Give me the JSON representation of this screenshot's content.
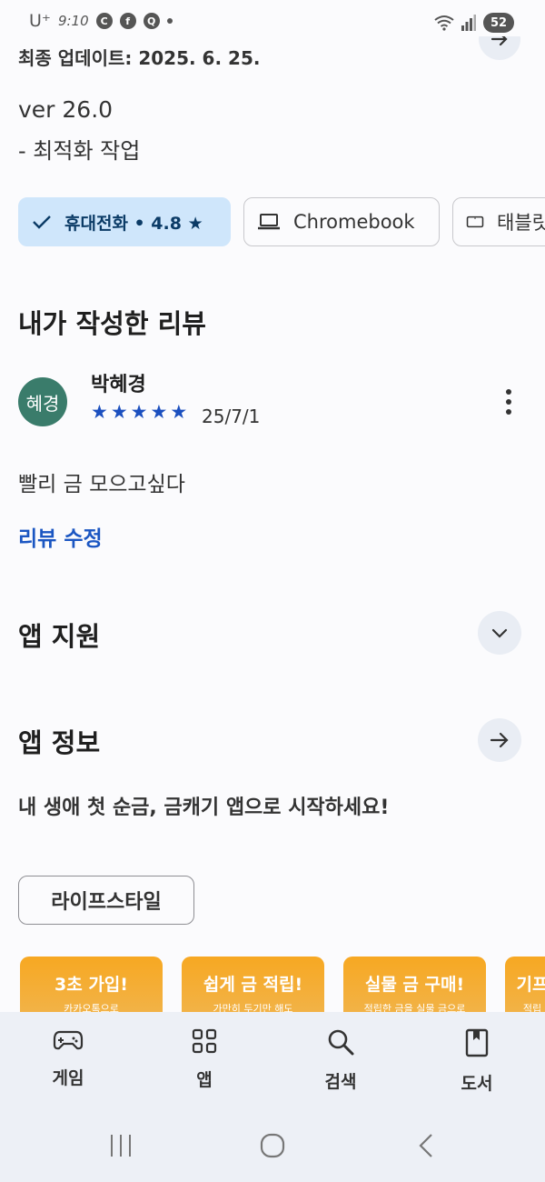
{
  "status_bar": {
    "carrier": "U⁺",
    "time": "9:10",
    "notification_icons": [
      "c-icon",
      "facebook-icon",
      "talk-icon"
    ],
    "battery": "52"
  },
  "details": {
    "update_label": "최종 업데이트: 2025. 6. 25.",
    "version": "ver 26.0",
    "version_note": "- 최적화 작업"
  },
  "device_chips": [
    {
      "label": "휴대전화 • 4.8 ★",
      "icon": "check-icon",
      "selected": true
    },
    {
      "label": "Chromebook",
      "icon": "laptop-icon",
      "selected": false
    },
    {
      "label": "태블릿",
      "icon": "tablet-icon",
      "selected": false
    }
  ],
  "my_review": {
    "section_title": "내가 작성한 리뷰",
    "avatar_text": "혜경",
    "avatar_color": "#3a7c6b",
    "reviewer": "박혜경",
    "rating": 5,
    "date": "25/7/1",
    "text": "빨리 금 모으고싶다",
    "edit_label": "리뷰 수정"
  },
  "app_support": {
    "title": "앱 지원"
  },
  "app_info": {
    "title": "앱 정보",
    "description": "내 생애 첫 순금, 금캐기 앱으로 시작하세요!",
    "tag": "라이프스타일"
  },
  "screenshots": [
    {
      "title": "3초 가입!",
      "subtitle": "카카오톡으로"
    },
    {
      "title": "쉽게 금 적립!",
      "subtitle": "가만히 두기만 해도"
    },
    {
      "title": "실물 금 구매!",
      "subtitle": "적립한 금을 실물 금으로"
    },
    {
      "title": "기프",
      "subtitle": "적립"
    }
  ],
  "bottom_nav": [
    {
      "label": "게임",
      "icon": "gamepad-icon"
    },
    {
      "label": "앱",
      "icon": "apps-grid-icon"
    },
    {
      "label": "검색",
      "icon": "search-icon"
    },
    {
      "label": "도서",
      "icon": "book-icon"
    }
  ],
  "colors": {
    "accent": "#1b56c2",
    "star": "#1b4fbf",
    "chip_selected_bg": "#cfe6fb",
    "nav_bg": "#edf0f6",
    "screenshot_bg": "#f7a822"
  }
}
